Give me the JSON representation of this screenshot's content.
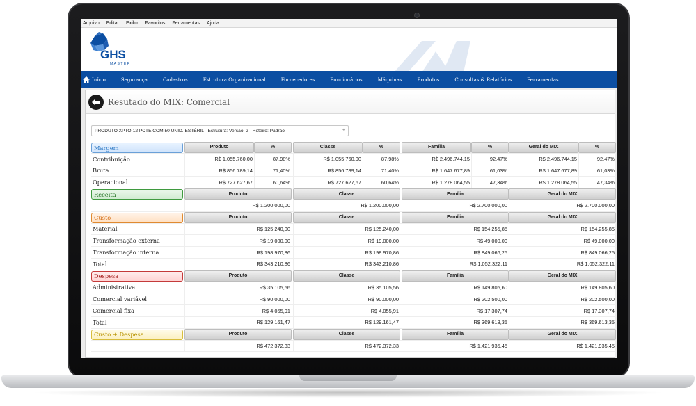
{
  "menu": [
    "Arquivo",
    "Editar",
    "Exibir",
    "Favoritos",
    "Ferramentas",
    "Ajuda"
  ],
  "logo": {
    "text": "GHS",
    "subtext": "MASTER"
  },
  "nav": {
    "home": "Início",
    "items": [
      "Segurança",
      "Cadastros",
      "Estrutura Organizacional",
      "Fornecedores",
      "Funcionários",
      "Máquinas",
      "Produtos",
      "Consultas & Relatórios",
      "Ferramentas"
    ]
  },
  "page": {
    "title": "Resutado do MIX: Comercial",
    "selector_value": "PRODUTO XPTO-12 PCTE COM 50 UNID. ESTÉRIL - Estrutura: Versão: 2 - Roteiro: Padrão",
    "selector_arrow": "+"
  },
  "columns": {
    "produto": "Produto",
    "classe": "Classe",
    "familia": "Família",
    "geral": "Geral do MIX",
    "pct": "%"
  },
  "margem": {
    "label": "Margem",
    "rows": [
      {
        "label": "Contribuição",
        "values": [
          "R$ 1.055.760,00",
          "87,98%",
          "R$ 1.055.760,00",
          "87,98%",
          "R$ 2.496.744,15",
          "92,47%",
          "R$ 2.496.744,15",
          "92,47%"
        ]
      },
      {
        "label": "Bruta",
        "values": [
          "R$ 856.789,14",
          "71,40%",
          "R$ 856.789,14",
          "71,40%",
          "R$ 1.647.677,89",
          "61,03%",
          "R$ 1.647.677,89",
          "61,03%"
        ]
      },
      {
        "label": "Operacional",
        "values": [
          "R$ 727.627,67",
          "60,64%",
          "R$ 727.627,67",
          "60,64%",
          "R$ 1.278.064,55",
          "47,34%",
          "R$ 1.278.064,55",
          "47,34%"
        ]
      }
    ]
  },
  "receita": {
    "label": "Receita",
    "values": [
      "R$ 1.200.000,00",
      "R$ 1.200.000,00",
      "R$ 2.700.000,00",
      "R$ 2.700.000,00"
    ]
  },
  "custo": {
    "label": "Custo",
    "rows": [
      {
        "label": "Material",
        "values": [
          "R$ 125.240,00",
          "R$ 125.240,00",
          "R$ 154.255,85",
          "R$ 154.255,85"
        ]
      },
      {
        "label": "Transformação externa",
        "values": [
          "R$ 19.000,00",
          "R$ 19.000,00",
          "R$ 49.000,00",
          "R$ 49.000,00"
        ]
      },
      {
        "label": "Transformação interna",
        "values": [
          "R$ 198.970,86",
          "R$ 198.970,86",
          "R$ 849.066,25",
          "R$ 849.066,25"
        ]
      },
      {
        "label": "Total",
        "values": [
          "R$ 343.210,86",
          "R$ 343.210,86",
          "R$ 1.052.322,11",
          "R$ 1.052.322,11"
        ]
      }
    ]
  },
  "despesa": {
    "label": "Despesa",
    "rows": [
      {
        "label": "Administrativa",
        "values": [
          "R$ 35.105,56",
          "R$ 35.105,56",
          "R$ 149.805,60",
          "R$ 149.805,60"
        ]
      },
      {
        "label": "Comercial variável",
        "values": [
          "R$ 90.000,00",
          "R$ 90.000,00",
          "R$ 202.500,00",
          "R$ 202.500,00"
        ]
      },
      {
        "label": "Comercial fixa",
        "values": [
          "R$ 4.055,91",
          "R$ 4.055,91",
          "R$ 17.307,74",
          "R$ 17.307,74"
        ]
      },
      {
        "label": "Total",
        "values": [
          "R$ 129.161,47",
          "R$ 129.161,47",
          "R$ 369.613,35",
          "R$ 369.613,35"
        ]
      }
    ]
  },
  "custo_despesa": {
    "label": "Custo + Despesa",
    "values": [
      "R$ 472.372,33",
      "R$ 472.372,33",
      "R$ 1.421.935,45",
      "R$ 1.421.935,45"
    ]
  },
  "colors": {
    "nav": "#0b4ea2",
    "margem": "#2c78c4",
    "receita": "#1f6f1f",
    "custo": "#d26a10",
    "despesa": "#a01818",
    "custo_despesa": "#b89300"
  }
}
